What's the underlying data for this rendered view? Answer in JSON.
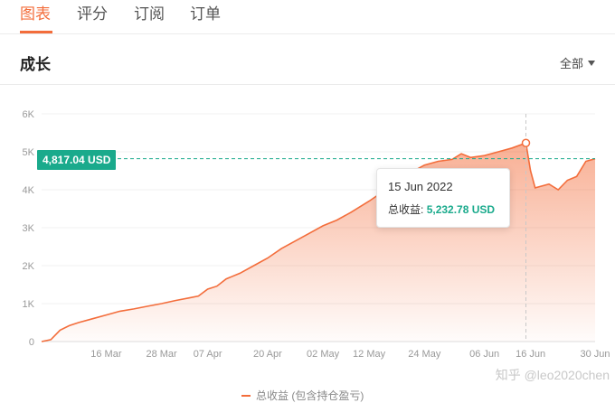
{
  "tabs": [
    {
      "label": "图表",
      "active": true
    },
    {
      "label": "评分",
      "active": false
    },
    {
      "label": "订阅",
      "active": false
    },
    {
      "label": "订单",
      "active": false
    }
  ],
  "section": {
    "title": "成长",
    "filter": "全部"
  },
  "colors": {
    "accent": "#f36d3b",
    "reference": "#1aaa8c"
  },
  "reference_line": {
    "label": "4,817.04 USD",
    "value": 4817.04
  },
  "tooltip": {
    "date": "15 Jun 2022",
    "label": "总收益:",
    "value": "5,232.78 USD"
  },
  "legend": {
    "label": "总收益 (包含持仓盈亏)"
  },
  "watermark": "知乎 @leo2020chen",
  "chart_data": {
    "type": "area",
    "xlabel": "",
    "ylabel": "",
    "ylim": [
      0,
      6000
    ],
    "yticks": [
      0,
      1000,
      2000,
      3000,
      4000,
      5000,
      6000
    ],
    "ytick_labels": [
      "0",
      "1K",
      "2K",
      "3K",
      "4K",
      "5K",
      "6K"
    ],
    "xticks": [
      "2022-03-16",
      "2022-03-28",
      "2022-04-07",
      "2022-04-20",
      "2022-05-02",
      "2022-05-12",
      "2022-05-24",
      "2022-06-06",
      "2022-06-16",
      "2022-06-30"
    ],
    "xtick_labels": [
      "16 Mar",
      "28 Mar",
      "07 Apr",
      "20 Apr",
      "02 May",
      "12 May",
      "24 May",
      "06 Jun",
      "16 Jun",
      "30 Jun"
    ],
    "xlim": [
      "2022-03-02",
      "2022-06-30"
    ],
    "grid": true,
    "legend_position": "bottom-center",
    "series": [
      {
        "name": "总收益 (包含持仓盈亏)",
        "x": [
          "2022-03-02",
          "2022-03-04",
          "2022-03-06",
          "2022-03-08",
          "2022-03-10",
          "2022-03-13",
          "2022-03-16",
          "2022-03-19",
          "2022-03-22",
          "2022-03-25",
          "2022-03-28",
          "2022-03-31",
          "2022-04-03",
          "2022-04-05",
          "2022-04-07",
          "2022-04-09",
          "2022-04-11",
          "2022-04-14",
          "2022-04-17",
          "2022-04-20",
          "2022-04-23",
          "2022-04-26",
          "2022-04-29",
          "2022-05-02",
          "2022-05-05",
          "2022-05-08",
          "2022-05-12",
          "2022-05-15",
          "2022-05-18",
          "2022-05-21",
          "2022-05-24",
          "2022-05-27",
          "2022-05-30",
          "2022-06-01",
          "2022-06-03",
          "2022-06-06",
          "2022-06-09",
          "2022-06-12",
          "2022-06-15",
          "2022-06-16",
          "2022-06-17",
          "2022-06-20",
          "2022-06-22",
          "2022-06-24",
          "2022-06-26",
          "2022-06-28",
          "2022-06-30"
        ],
        "values": [
          0,
          50,
          300,
          420,
          500,
          600,
          700,
          800,
          860,
          930,
          1000,
          1080,
          1150,
          1200,
          1380,
          1460,
          1650,
          1800,
          2000,
          2200,
          2450,
          2650,
          2850,
          3050,
          3200,
          3400,
          3700,
          3950,
          4200,
          4450,
          4650,
          4750,
          4800,
          4950,
          4850,
          4900,
          5000,
          5100,
          5232.78,
          4500,
          4050,
          4150,
          4000,
          4250,
          4350,
          4750,
          4817.04
        ]
      }
    ]
  }
}
